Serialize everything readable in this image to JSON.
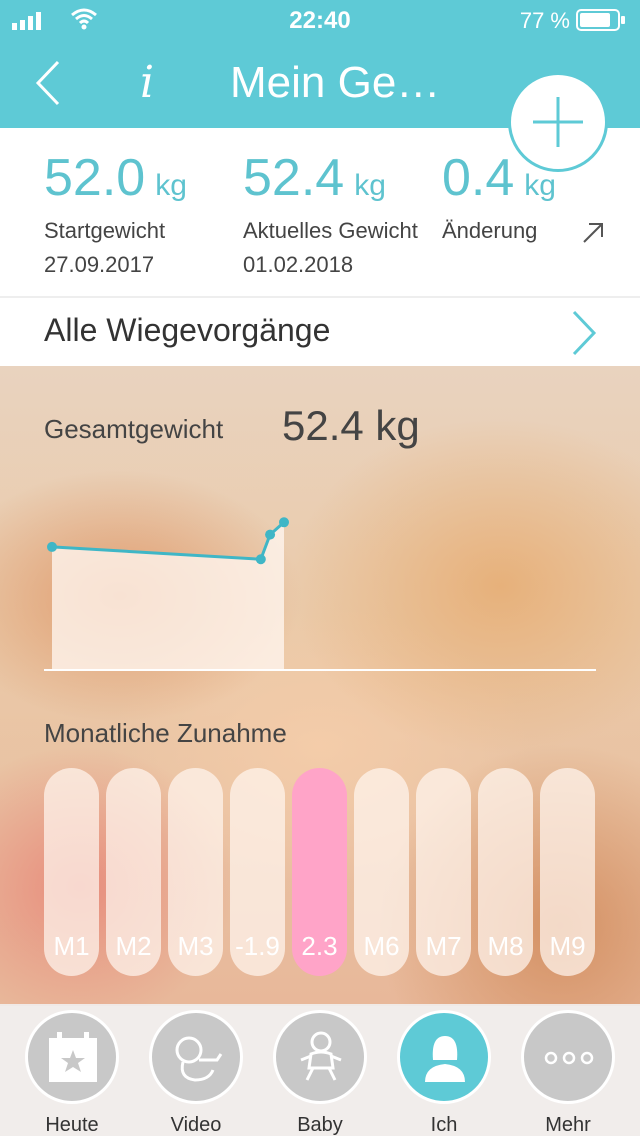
{
  "status": {
    "time": "22:40",
    "battery": "77 %"
  },
  "header": {
    "title": "Mein Ge…",
    "info_label": "i"
  },
  "stats": [
    {
      "value": "52.0",
      "unit": "kg",
      "label": "Startgewicht",
      "date": "27.09.2017"
    },
    {
      "value": "52.4",
      "unit": "kg",
      "label": "Aktuelles Gewicht",
      "date": "01.02.2018"
    },
    {
      "value": "0.4",
      "unit": "kg",
      "label": "Änderung"
    }
  ],
  "all_weighings": {
    "label": "Alle Wiegevorgänge"
  },
  "weight_chart": {
    "title": "Gesamtgewicht",
    "current": "52.4 kg"
  },
  "chart_data": {
    "type": "line",
    "title": "Gesamtgewicht",
    "series": [
      {
        "values": [
          52.0,
          51.8,
          52.2,
          52.4
        ]
      }
    ],
    "x_positions": [
      0.0,
      0.9,
      0.94,
      1.0
    ],
    "ylim": [
      50.0,
      52.6
    ],
    "grid": false,
    "line_color": "#3fb6c6"
  },
  "monthly": {
    "title": "Monatliche Zunahme",
    "months": [
      "M1",
      "M2",
      "M3",
      "-1.9",
      "2.3",
      "M6",
      "M7",
      "M8",
      "M9"
    ],
    "active_index": 4
  },
  "tabs": [
    {
      "label": "Heute",
      "icon": "calendar-icon"
    },
    {
      "label": "Video",
      "icon": "fetus-icon"
    },
    {
      "label": "Baby",
      "icon": "baby-icon"
    },
    {
      "label": "Ich",
      "icon": "person-icon"
    },
    {
      "label": "Mehr",
      "icon": "more-icon"
    }
  ],
  "colors": {
    "accent": "#5ecad6",
    "highlight": "#ffa4c8"
  }
}
